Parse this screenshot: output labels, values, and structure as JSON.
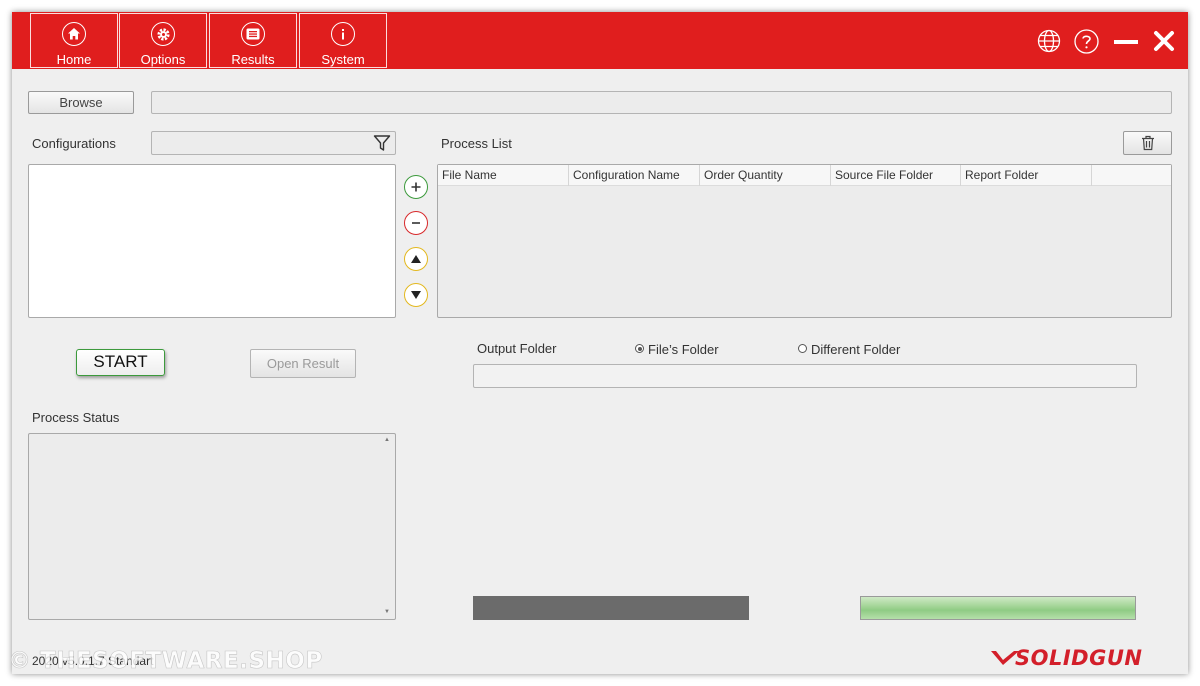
{
  "nav": {
    "items": [
      {
        "label": "Home"
      },
      {
        "label": "Options"
      },
      {
        "label": "Results"
      },
      {
        "label": "System"
      }
    ]
  },
  "top_icons": [
    "globe-icon",
    "help-icon",
    "minimize-icon",
    "close-icon"
  ],
  "browse": {
    "label": "Browse",
    "path": ""
  },
  "configurations": {
    "label": "Configurations",
    "filter_value": ""
  },
  "process_list": {
    "label": "Process List",
    "columns": [
      "File Name",
      "Configuration Name",
      "Order Quantity",
      "Source File Folder",
      "Report Folder"
    ]
  },
  "actions": {
    "start_label": "START",
    "open_result_label": "Open Result"
  },
  "output": {
    "label": "Output Folder",
    "options": [
      {
        "label": "File’s Folder",
        "selected": true
      },
      {
        "label": "Different Folder",
        "selected": false
      }
    ],
    "path": ""
  },
  "process_status": {
    "label": "Process Status"
  },
  "footer": {
    "version": "2020 v5.0.1.7 Standart",
    "brand": "SOLIDGUN",
    "watermark": "© THESOFTWARE.SHOP"
  },
  "colors": {
    "accent_red": "#e01e1e",
    "start_green": "#3c9a3c",
    "remove_red": "#d8282a",
    "move_yellow": "#e3b81e"
  }
}
